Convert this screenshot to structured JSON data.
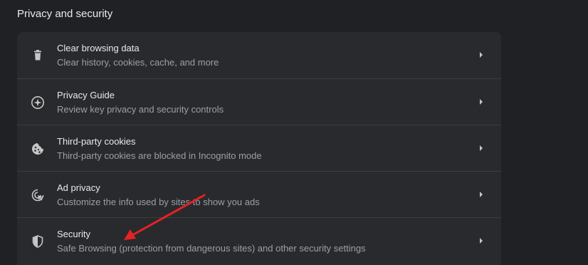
{
  "section": {
    "title": "Privacy and security"
  },
  "rows": [
    {
      "title": "Clear browsing data",
      "subtitle": "Clear history, cookies, cache, and more",
      "icon": "trash-icon"
    },
    {
      "title": "Privacy Guide",
      "subtitle": "Review key privacy and security controls",
      "icon": "compass-icon"
    },
    {
      "title": "Third-party cookies",
      "subtitle": "Third-party cookies are blocked in Incognito mode",
      "icon": "cookie-icon"
    },
    {
      "title": "Ad privacy",
      "subtitle": "Customize the info used by sites to show you ads",
      "icon": "ad-privacy-icon"
    },
    {
      "title": "Security",
      "subtitle": "Safe Browsing (protection from dangerous sites) and other security settings",
      "icon": "shield-icon"
    }
  ],
  "colors": {
    "background": "#202124",
    "card": "#292a2d",
    "text_primary": "#e8eaed",
    "text_secondary": "#9aa0a6",
    "annotation_arrow": "#e52222"
  }
}
